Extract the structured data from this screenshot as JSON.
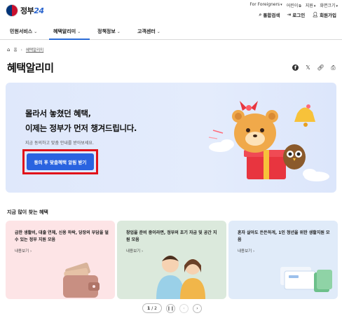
{
  "header": {
    "logo_text": "정부",
    "logo_num": "24",
    "utility": [
      "For Foreigners",
      "어린이",
      "지원",
      "화면크기"
    ],
    "member": {
      "search": "통합검색",
      "login": "로그인",
      "signup": "회원가입"
    }
  },
  "nav": [
    {
      "label": "민원서비스"
    },
    {
      "label": "혜택알리미"
    },
    {
      "label": "정책정보"
    },
    {
      "label": "고객센터"
    }
  ],
  "breadcrumb": {
    "home": "홈",
    "current": "혜택알리미"
  },
  "page": {
    "title": "혜택알리미"
  },
  "share_icons": [
    "facebook-icon",
    "x-icon",
    "link-icon",
    "print-icon"
  ],
  "hero": {
    "line1": "몰라서 놓쳤던 혜택,",
    "line2": "이제는 정부가 먼저 챙겨드립니다.",
    "sub": "지금 동의하고 맞춤 안내를 받아보세요.",
    "button": "동의 후 맞춤혜택 알림 받기"
  },
  "section": {
    "title": "지금 많이 찾는 혜택"
  },
  "cards": [
    {
      "title": "급한 생활비, 대출 연체, 신용 하락, 당장의 부담을 덜 수 있는 정부 지원 모음",
      "link": "내용보기"
    },
    {
      "title": "창업을 준비 중이라면, 정부의 초기 자금 및 공간 지원 모음",
      "link": "내용보기"
    },
    {
      "title": "혼자 살아도 든든하게, 1인 청년을 위한 생활지원 모음",
      "link": "내용보기"
    }
  ],
  "pager": {
    "current": "1",
    "total": "/ 2"
  },
  "colors": {
    "accent": "#2a63e0",
    "highlight_frame": "#e1121a",
    "hero_bg": "#dfe8fb"
  }
}
